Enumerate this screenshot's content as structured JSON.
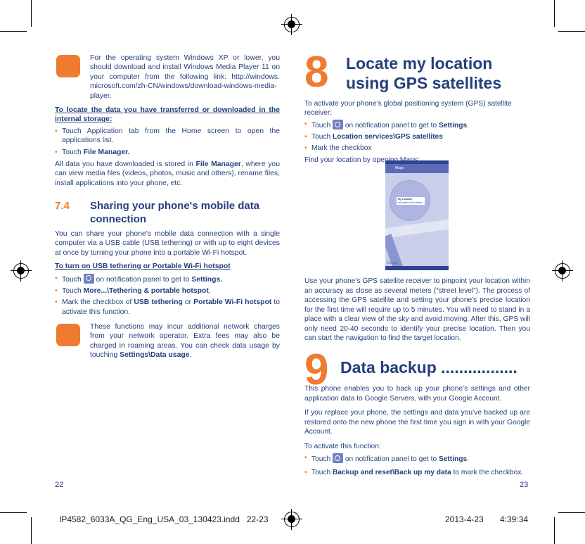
{
  "left": {
    "tip1": "For the operating system Windows XP or lower, you should download and install Windows Media Player 11 on your computer from the following link: http://windows. microsoft.com/zh-CN/windows/download-windows-media-player.",
    "locate_heading": "To locate the data you have transferred or downloaded in the internal storage:",
    "b1": "Touch Application tab from the Home screen to open the applications list.",
    "b2_pre": "Touch ",
    "b2_bold": "File Manager.",
    "p1_pre": "All data you have downloaded is stored in ",
    "p1_bold": "File Manager",
    "p1_post": ", where you can view media files (videos, photos, music and others), rename files, install applications into your phone, etc.",
    "sec_num": "7.4",
    "sec_title": "Sharing your phone's mobile data connection",
    "p2": "You can share your phone's mobile data connection with a single computer via a USB cable (USB tethering) or with up to eight devices at once by turning your phone into a portable Wi-Fi hotspot.",
    "usb_heading": "To turn on USB tethering or Portable Wi-Fi hotspot",
    "u1_pre": "Touch ",
    "u1_mid": " on notification panel to get to ",
    "u1_bold": "Settings.",
    "u2_pre": "Touch ",
    "u2_bold": "More...\\Tethering & portable hotspot",
    "u2_post": ".",
    "u3_pre": "Mark the checkbox of ",
    "u3_b1": "USB tethering",
    "u3_mid": " or ",
    "u3_b2": "Portable Wi-Fi hotspot",
    "u3_post": " to activate this function.",
    "tip2_pre": "These functions may incur additional network charges from your network operator. Extra fees may also be charged in roaming areas. You can check data usage by touching ",
    "tip2_bold": "Settings\\Data usage",
    "tip2_post": ".",
    "page": "22"
  },
  "right": {
    "ch8_num": "8",
    "ch8_title": "Locate my location using GPS satellites",
    "intro": "To activate your phone’s global positioning system (GPS) satellite receiver:",
    "g1_pre": "Touch ",
    "g1_mid": " on notification panel to get to ",
    "g1_bold": "Settings",
    "g1_post": ".",
    "g2_pre": "Touch ",
    "g2_bold": "Location services\\GPS satellites",
    "g3": "Mark the checkbox",
    "find": "Find your location by opening Maps:",
    "map": {
      "app": "Maps",
      "pin_title": "My Location",
      "pin_sub": "Accurate to 30 meters",
      "logo": "Google"
    },
    "gps_para": "Use your phone’s GPS satellite receiver to pinpoint your location within an accuracy as close as several meters (“street level”). The process of accessing the GPS satellite and setting your phone's precise location for the first time will require up to 5 minutes. You will need to stand in a place with a clear view of the sky and avoid moving. After this, GPS will only need 20-40 seconds to identify your precise location. Then you can start the navigation to find the target location.",
    "ch9_num": "9",
    "ch9_title": "Data backup .................",
    "d1": "This phone enables you to back up your phone’s settings and other application data to Google Servers, with your Google Account.",
    "d2": "If you replace your phone, the settings and data you’ve backed up are restored onto the new phone the first time you sign in with your Google Account.",
    "d3": "To activate this function:",
    "k1_pre": "Touch ",
    "k1_mid": " on notification panel to get to ",
    "k1_bold": "Settings",
    "k1_post": ".",
    "k2_pre": "Touch ",
    "k2_bold": "Backup and reset\\Back up my data",
    "k2_post": " to mark the checkbox.",
    "page": "23"
  },
  "footer": {
    "file": "IP4582_6033A_QG_Eng_USA_03_130423.indd   22-23",
    "date": "2013-4-23",
    "time": "4:39:34"
  },
  "colors": {
    "text": "#233f7c",
    "accent": "#f07a30"
  }
}
